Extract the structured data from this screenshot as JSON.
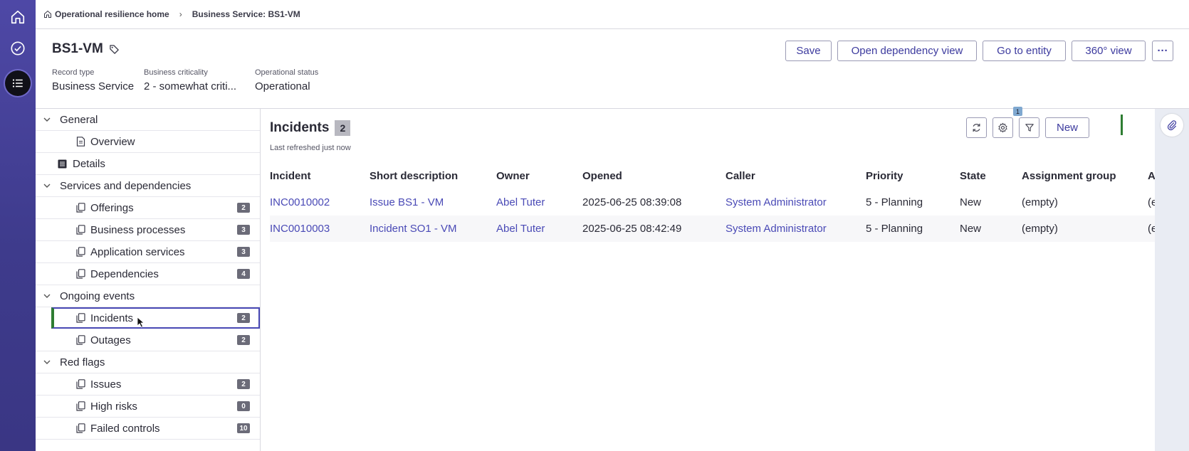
{
  "breadcrumb": {
    "home_label": "Operational resilience home",
    "current_label": "Business Service: BS1-VM"
  },
  "record": {
    "title": "BS1-VM",
    "fields": [
      {
        "label": "Record type",
        "value": "Business Service"
      },
      {
        "label": "Business criticality",
        "value": "2 - somewhat criti..."
      },
      {
        "label": "Operational status",
        "value": "Operational"
      }
    ]
  },
  "header_actions": {
    "save": "Save",
    "dependency_view": "Open dependency view",
    "go_to_entity": "Go to entity",
    "view_360": "360° view",
    "more": "···"
  },
  "nav": {
    "general": "General",
    "overview": "Overview",
    "details": "Details",
    "services_section": "Services and dependencies",
    "offerings": {
      "label": "Offerings",
      "count": "2"
    },
    "business_processes": {
      "label": "Business processes",
      "count": "3"
    },
    "application_services": {
      "label": "Application services",
      "count": "3"
    },
    "dependencies": {
      "label": "Dependencies",
      "count": "4"
    },
    "ongoing_section": "Ongoing events",
    "incidents": {
      "label": "Incidents",
      "count": "2"
    },
    "outages": {
      "label": "Outages",
      "count": "2"
    },
    "red_flags_section": "Red flags",
    "issues": {
      "label": "Issues",
      "count": "2"
    },
    "high_risks": {
      "label": "High risks",
      "count": "0"
    },
    "failed_controls": {
      "label": "Failed controls",
      "count": "10"
    }
  },
  "list": {
    "title": "Incidents",
    "count": "2",
    "refreshed": "Last refreshed just now",
    "filter_count": "1",
    "new_label": "New",
    "columns": [
      "Incident",
      "Short description",
      "Owner",
      "Opened",
      "Caller",
      "Priority",
      "State",
      "Assignment group",
      "A"
    ],
    "rows": [
      {
        "number": "INC0010002",
        "short_description": "Issue BS1 - VM",
        "owner": "Abel Tuter",
        "opened": "2025-06-25 08:39:08",
        "caller": "System Administrator",
        "priority": "5 - Planning",
        "state": "New",
        "assignment_group": "(empty)",
        "overflow": "(e"
      },
      {
        "number": "INC0010003",
        "short_description": "Incident SO1 - VM",
        "owner": "Abel Tuter",
        "opened": "2025-06-25 08:42:49",
        "caller": "System Administrator",
        "priority": "5 - Planning",
        "state": "New",
        "assignment_group": "(empty)",
        "overflow": "(e"
      }
    ]
  },
  "colors": {
    "rail": "#4e48a6",
    "link": "#4a4ab6",
    "button_text": "#3c3a9e",
    "selection_border": "#4848b4",
    "accent_green": "#2e7d32"
  }
}
